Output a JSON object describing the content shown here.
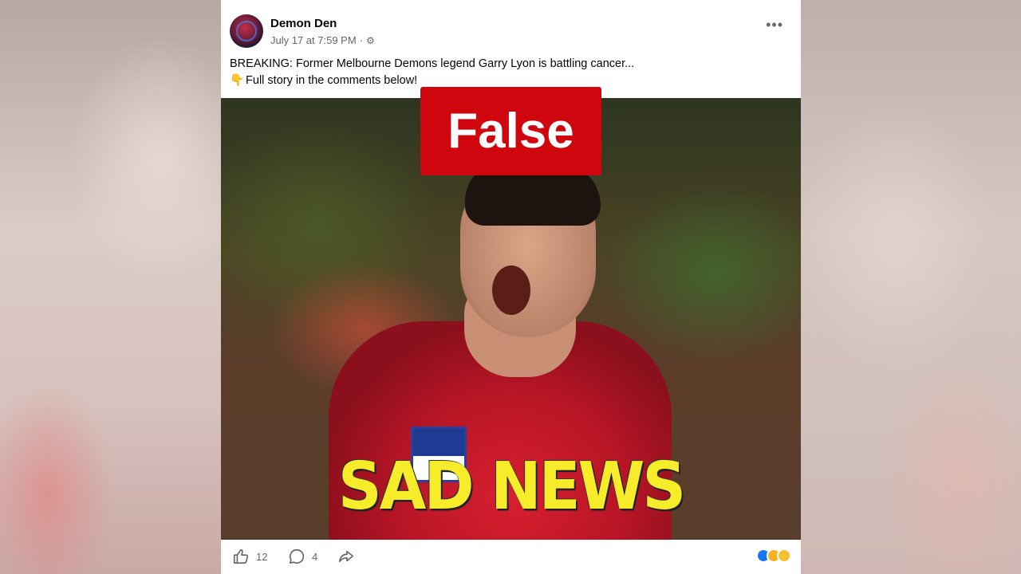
{
  "post": {
    "author": "Demon Den",
    "timestamp": "July 17 at 7:59 PM",
    "separator": "·",
    "more_label": "•••",
    "text_line1": "BREAKING: Former Melbourne Demons legend Garry Lyon is battling cancer...",
    "text_line2": "Full story in the comments below!",
    "pointing_emoji": "👇"
  },
  "image": {
    "overlay_caption": "SAD NEWS",
    "fact_check_label": "False"
  },
  "actions": {
    "like_count": "12",
    "comment_count": "4"
  },
  "colors": {
    "fact_check_bg": "#d0060f",
    "caption_text": "#f6ec2a",
    "jersey_red": "#d81f30"
  },
  "icons": [
    "avatar",
    "gear-icon",
    "more-icon",
    "like-icon",
    "comment-icon",
    "share-icon",
    "reaction-like-icon",
    "reaction-care-icon",
    "reaction-wow-icon"
  ]
}
